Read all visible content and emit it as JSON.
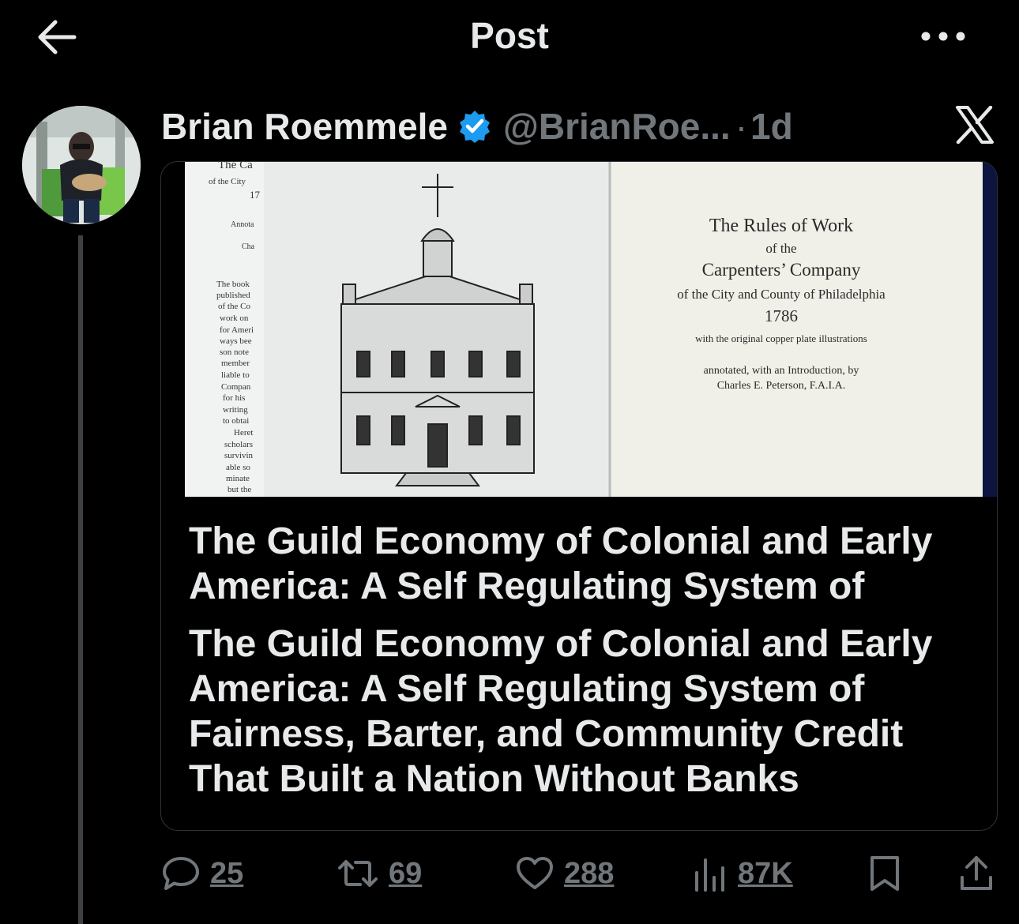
{
  "header": {
    "title": "Post"
  },
  "author": {
    "display_name": "Brian Roemmele",
    "handle": "@BrianRoe...",
    "separator": "·",
    "time": "1d"
  },
  "card": {
    "image": {
      "left_page_lines": [
        "The Ca",
        "of the City",
        "17",
        "Annota",
        "Cha",
        "The book",
        "published",
        "of the Co",
        "work on",
        "for Ameri",
        "ways bee",
        "son note",
        "member",
        "liable to",
        "Compan",
        "for his",
        "writing",
        "to obtai",
        "Heret",
        "scholars",
        "survivin",
        "able so",
        "minate",
        "but the"
      ],
      "right_page": {
        "line1": "The Rules of Work",
        "line2": "of the",
        "line3": "Carpenters’ Company",
        "line4": "of the City and County of Philadelphia",
        "line5": "1786",
        "line6": "with the original copper plate illustrations",
        "line7": "annotated, with an Introduction, by",
        "line8": "Charles E. Peterson, F.A.I.A."
      }
    },
    "title": "The Guild Economy of Colonial and Early America: A Self Regulating System of",
    "description": "The Guild Economy of Colonial and Early America: A Self Regulating System of Fairness, Barter, and Community Credit That Built a Nation Without Banks"
  },
  "actions": {
    "replies": "25",
    "reposts": "69",
    "likes": "288",
    "views": "87K"
  },
  "colors": {
    "background": "#000000",
    "text": "#e7e9ea",
    "muted": "#71767b",
    "verified": "#1d9bf0",
    "border": "#2f3336"
  }
}
